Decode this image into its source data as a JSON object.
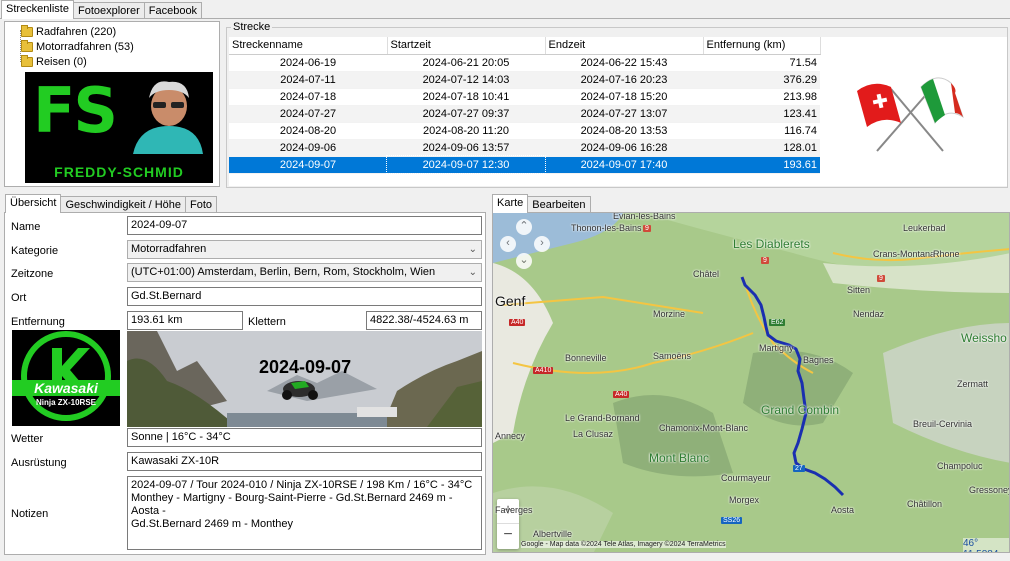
{
  "top_tabs": [
    "Streckenliste",
    "Fotoexplorer",
    "Facebook"
  ],
  "tree": [
    {
      "label": "Radfahren (220)"
    },
    {
      "label": "Motorradfahren (53)"
    },
    {
      "label": "Reisen (0)"
    }
  ],
  "logo": {
    "letters": "FS",
    "text": "FREDDY-SCHMID"
  },
  "strecke": {
    "group_title": "Strecke",
    "columns": [
      "Streckenname",
      "Startzeit",
      "Endzeit",
      "Entfernung (km)"
    ],
    "rows": [
      {
        "name": "2024-06-19",
        "start": "2024-06-21 20:05",
        "end": "2024-06-22 15:43",
        "dist": "71.54"
      },
      {
        "name": "2024-07-11",
        "start": "2024-07-12 14:03",
        "end": "2024-07-16 20:23",
        "dist": "376.29"
      },
      {
        "name": "2024-07-18",
        "start": "2024-07-18 10:41",
        "end": "2024-07-18 15:20",
        "dist": "213.98"
      },
      {
        "name": "2024-07-27",
        "start": "2024-07-27 09:37",
        "end": "2024-07-27 13:07",
        "dist": "123.41"
      },
      {
        "name": "2024-08-20",
        "start": "2024-08-20 11:20",
        "end": "2024-08-20 13:53",
        "dist": "116.74"
      },
      {
        "name": "2024-09-06",
        "start": "2024-09-06 13:57",
        "end": "2024-09-06 16:28",
        "dist": "128.01"
      },
      {
        "name": "2024-09-07",
        "start": "2024-09-07 12:30",
        "end": "2024-09-07 17:40",
        "dist": "193.61"
      }
    ]
  },
  "detail_tabs": [
    "Übersicht",
    "Geschwindigkeit / Höhe",
    "Foto"
  ],
  "form": {
    "name_label": "Name",
    "name_value": "2024-09-07",
    "kategorie_label": "Kategorie",
    "kategorie_value": "Motorradfahren",
    "zeitzone_label": "Zeitzone",
    "zeitzone_value": "(UTC+01:00) Amsterdam, Berlin, Bern, Rom, Stockholm, Wien",
    "ort_label": "Ort",
    "ort_value": "Gd.St.Bernard",
    "entfernung_label": "Entfernung",
    "entfernung_value": "193.61 km",
    "klettern_label": "Klettern",
    "klettern_value": "4822.38/-4524.63 m",
    "wetter_label": "Wetter",
    "wetter_value": "Sonne | 16°C - 34°C",
    "ausruestung_label": "Ausrüstung",
    "ausruestung_value": "Kawasaki ZX-10R",
    "notizen_label": "Notizen",
    "notizen_lines": [
      "2024-09-07 / Tour 2024-010 / Ninja ZX-10RSE / 198 Km / 16°C - 34°C",
      "Monthey - Martigny - Bourg-Saint-Pierre - Gd.St.Bernard 2469 m - Aosta -",
      "Gd.St.Bernard 2469 m - Monthey"
    ]
  },
  "kawasaki": {
    "brand": "Kawasaki",
    "model": "Ninja ZX-10RSE"
  },
  "photo_date": "2024-09-07",
  "map_tabs": [
    "Karte",
    "Bearbeiten"
  ],
  "map": {
    "places": [
      {
        "name": "Evian-les-Bains"
      },
      {
        "name": "Thonon-les-Bains"
      },
      {
        "name": "Les Diablerets"
      },
      {
        "name": "Leukerbad"
      },
      {
        "name": "Crans-Montana"
      },
      {
        "name": "Rhone"
      },
      {
        "name": "Châtel"
      },
      {
        "name": "Sitten"
      },
      {
        "name": "Genf"
      },
      {
        "name": "Morzine"
      },
      {
        "name": "Nendaz"
      },
      {
        "name": "Weissho"
      },
      {
        "name": "Martigny"
      },
      {
        "name": "Bagnes"
      },
      {
        "name": "Bonneville"
      },
      {
        "name": "Samoëns"
      },
      {
        "name": "Zermatt"
      },
      {
        "name": "Grand Combin"
      },
      {
        "name": "Le Grand-Bornand"
      },
      {
        "name": "Chamonix-Mont-Blanc"
      },
      {
        "name": "Breuil-Cervinia"
      },
      {
        "name": "La Clusaz"
      },
      {
        "name": "Annecy"
      },
      {
        "name": "Mont Blanc"
      },
      {
        "name": "Courmayeur"
      },
      {
        "name": "Champoluc"
      },
      {
        "name": "Morgex"
      },
      {
        "name": "Gressoney-Sain"
      },
      {
        "name": "Aosta"
      },
      {
        "name": "Châtillon"
      },
      {
        "name": "Albertville"
      },
      {
        "name": "Faverges"
      }
    ],
    "roads": [
      "A40",
      "A410",
      "A40",
      "E62",
      "9",
      "9",
      "27",
      "SS26",
      "9"
    ],
    "attribution": "Google - Map data ©2024 Tele Atlas, Imagery ©2024 TerraMetrics",
    "coord": "46° 11.5884"
  },
  "colors": {
    "selection": "#0078d7",
    "route": "#1a2fb0",
    "logo_green": "#22cc22"
  }
}
